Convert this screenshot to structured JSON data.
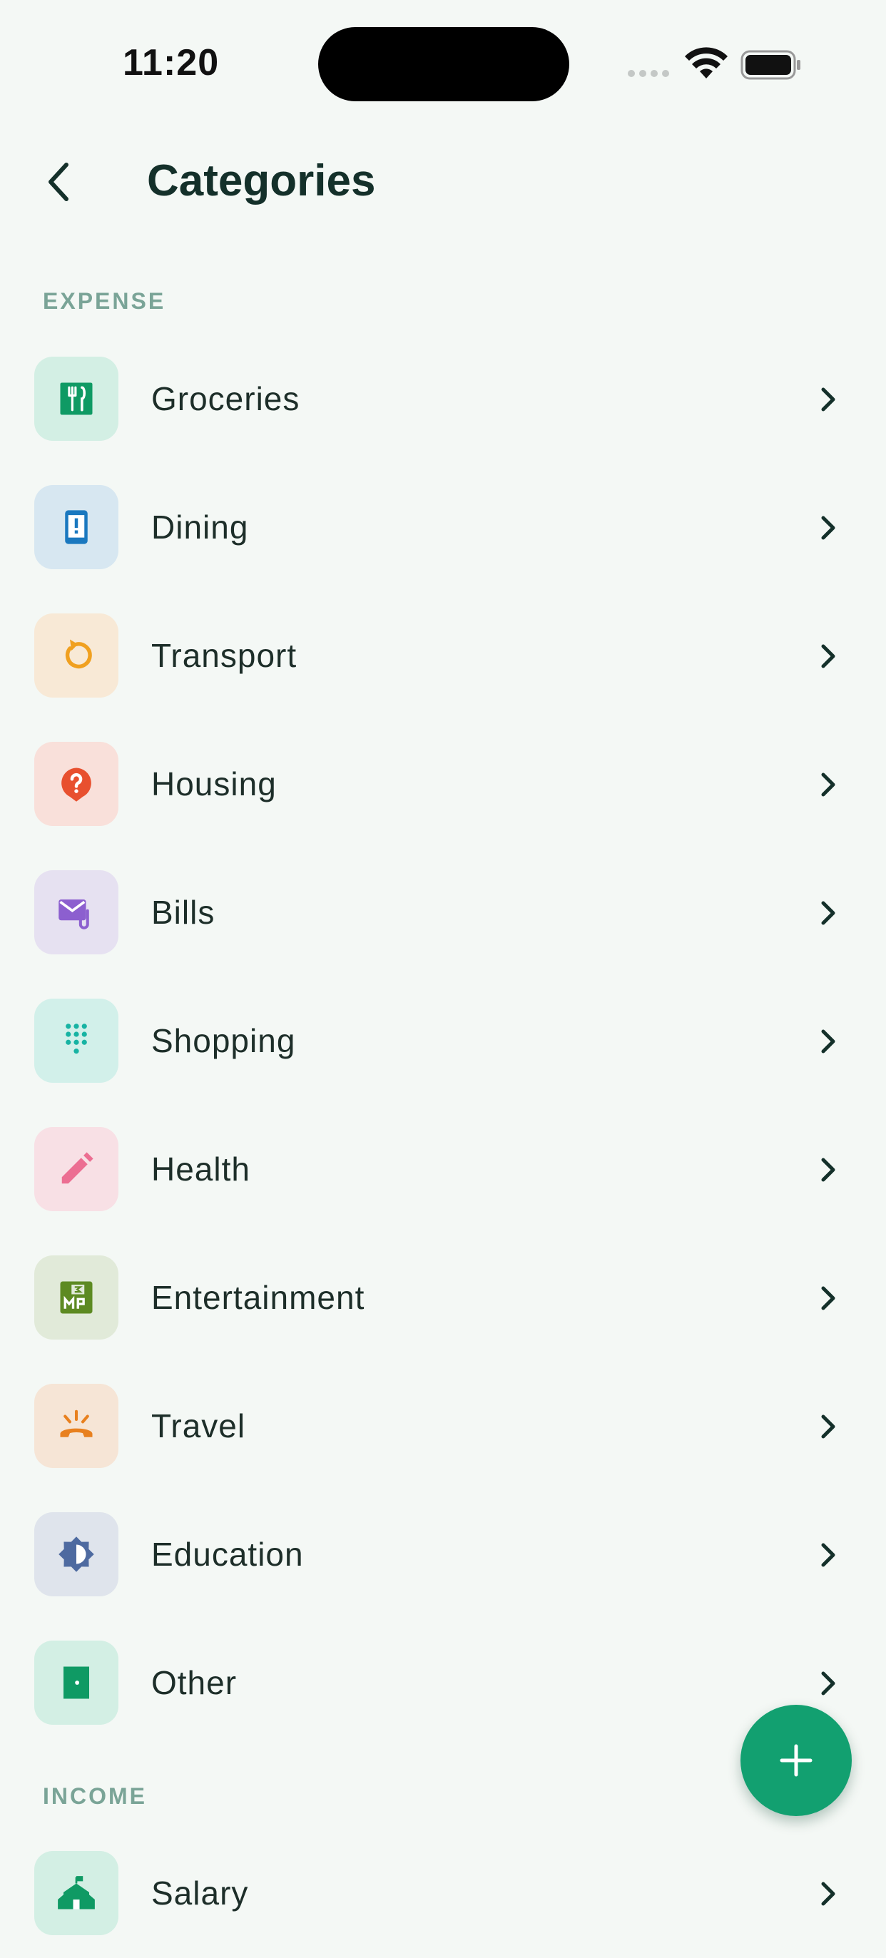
{
  "status_bar": {
    "time": "11:20"
  },
  "header": {
    "title": "Categories",
    "back_icon": "chevron-left-icon"
  },
  "sections": {
    "expense": {
      "label": "EXPENSE",
      "items": [
        {
          "label": "Groceries",
          "icon": "restaurant-icon",
          "tile_color": "#d3efe4",
          "icon_color": "#0f9a64"
        },
        {
          "label": "Dining",
          "icon": "phone-alert-icon",
          "tile_color": "#d7e7f1",
          "icon_color": "#1a78bf"
        },
        {
          "label": "Transport",
          "icon": "refresh-icon",
          "tile_color": "#f8e9d6",
          "icon_color": "#f0a020"
        },
        {
          "label": "Housing",
          "icon": "help-bubble-icon",
          "tile_color": "#f9e0da",
          "icon_color": "#e8502f"
        },
        {
          "label": "Bills",
          "icon": "mail-attachment-icon",
          "tile_color": "#e6e1f1",
          "icon_color": "#8c5fcf"
        },
        {
          "label": "Shopping",
          "icon": "dialpad-icon",
          "tile_color": "#d2f0ea",
          "icon_color": "#17b3a3"
        },
        {
          "label": "Health",
          "icon": "pencil-icon",
          "tile_color": "#f8e0e5",
          "icon_color": "#ec6e92"
        },
        {
          "label": "Entertainment",
          "icon": "calendar-badge-icon",
          "tile_color": "#e1ead9",
          "icon_color": "#5d8a22"
        },
        {
          "label": "Travel",
          "icon": "phone-ringing-icon",
          "tile_color": "#f6e5d6",
          "icon_color": "#e8801f"
        },
        {
          "label": "Education",
          "icon": "brightness-icon",
          "tile_color": "#dfe4ec",
          "icon_color": "#4e6aa0"
        },
        {
          "label": "Other",
          "icon": "door-icon",
          "tile_color": "#d3efe4",
          "icon_color": "#0f9a64"
        }
      ]
    },
    "income": {
      "label": "INCOME",
      "items": [
        {
          "label": "Salary",
          "icon": "school-building-icon",
          "tile_color": "#d3efe4",
          "icon_color": "#0f9a64"
        }
      ]
    }
  },
  "fab": {
    "icon": "plus-icon"
  },
  "colors": {
    "background": "#f4f8f5",
    "accent": "#12a070",
    "section_label": "#7aa497"
  }
}
